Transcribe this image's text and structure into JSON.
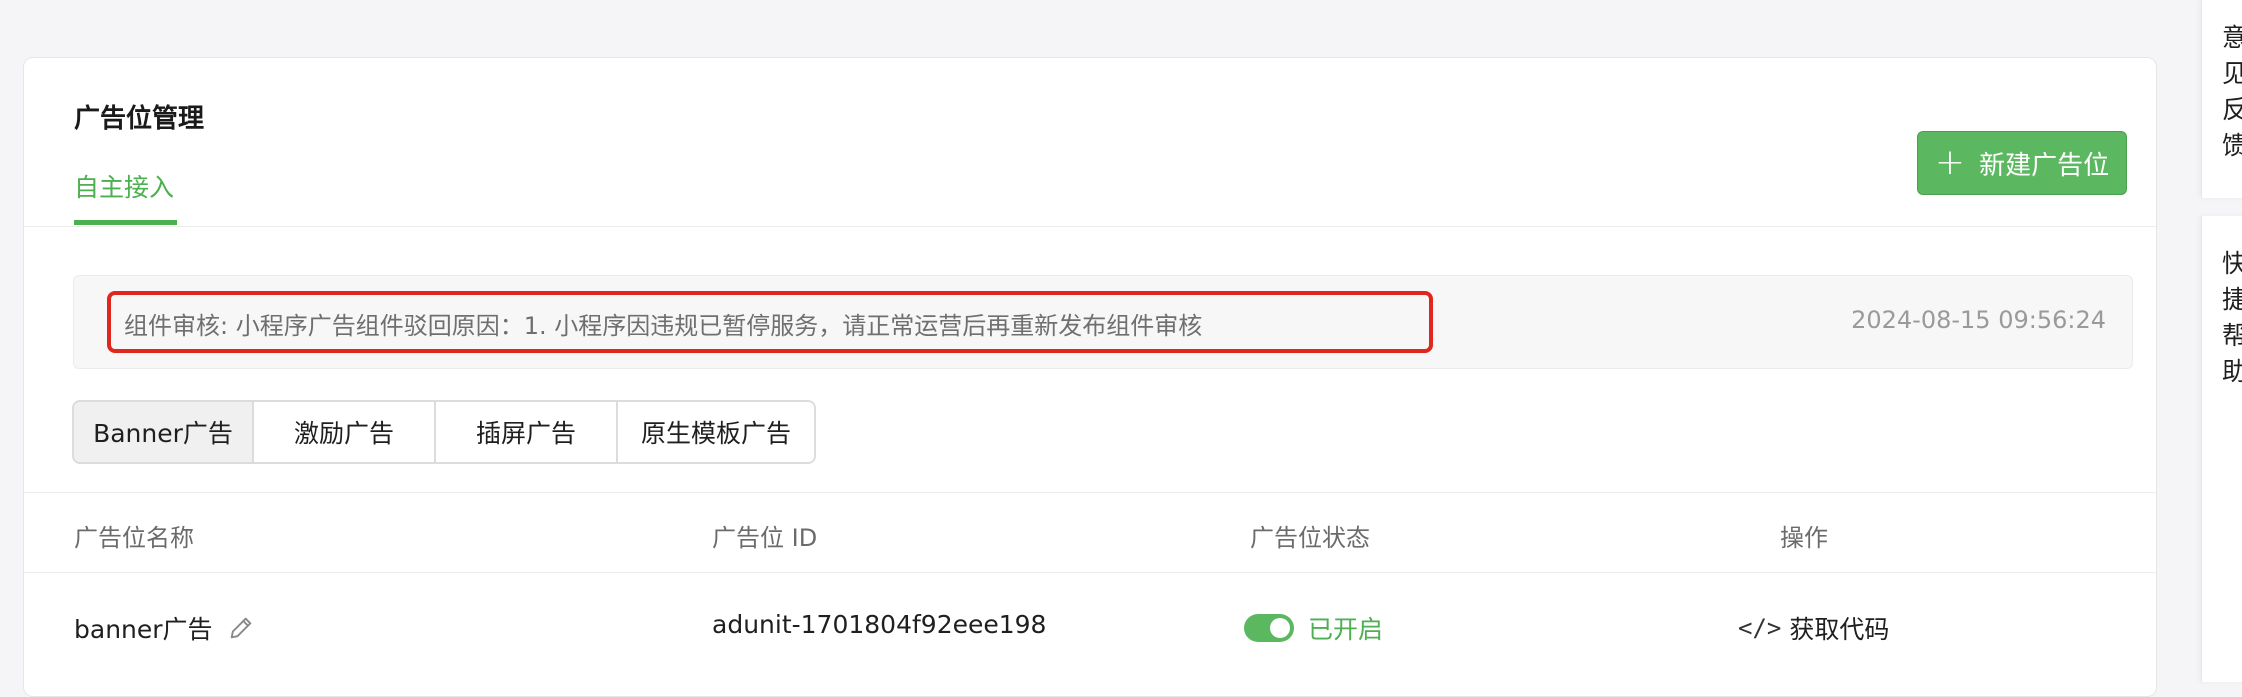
{
  "card": {
    "title": "广告位管理",
    "tab": "自主接入",
    "new_button": "新建广告位"
  },
  "notice": {
    "text": "组件审核: 小程序广告组件驳回原因：1. 小程序因违规已暂停服务，请正常运营后再重新发布组件审核",
    "time": "2024-08-15 09:56:24"
  },
  "ad_types": [
    {
      "label": "Banner广告",
      "active": true
    },
    {
      "label": "激励广告",
      "active": false
    },
    {
      "label": "插屏广告",
      "active": false
    },
    {
      "label": "原生模板广告",
      "active": false
    }
  ],
  "table": {
    "columns": [
      "广告位名称",
      "广告位 ID",
      "广告位状态",
      "操作"
    ],
    "rows": [
      {
        "name": "banner广告",
        "id": "adunit-1701804f92eee198",
        "status": "已开启",
        "action": "获取代码"
      }
    ]
  },
  "side": {
    "feedback": "意见反馈",
    "help": "快捷帮助"
  },
  "colors": {
    "accent": "#4caf50",
    "button_bg": "#5cb860",
    "highlight_border": "#e0271d"
  }
}
